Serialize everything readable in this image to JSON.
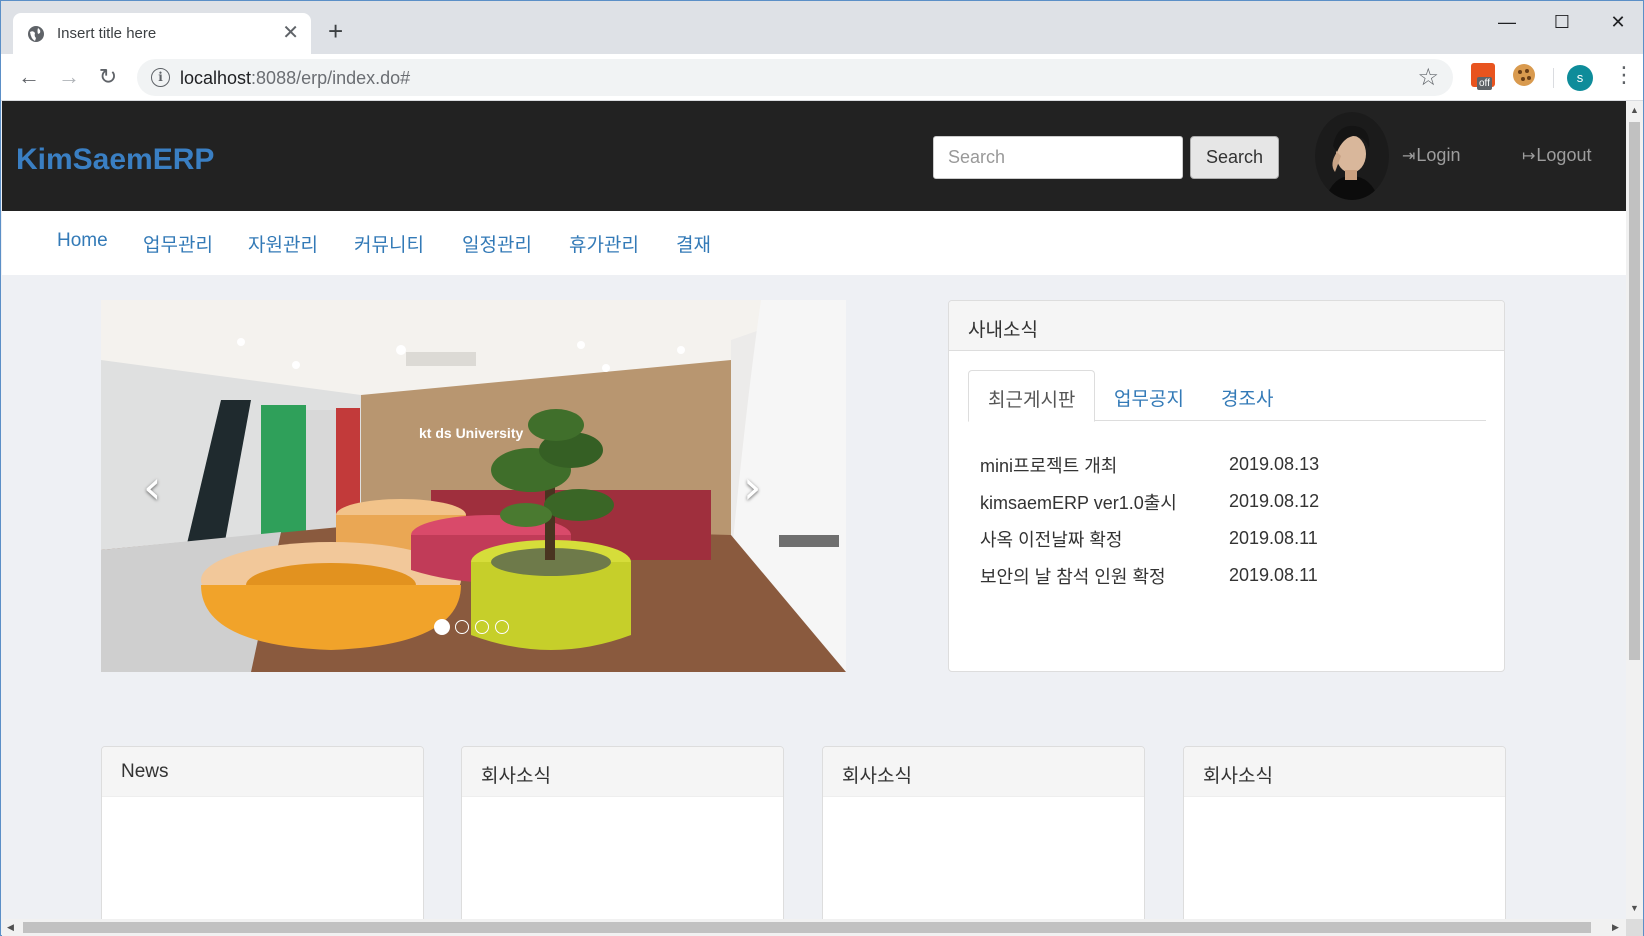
{
  "browser": {
    "tab_title": "Insert title here",
    "tab_close": "✕",
    "new_tab": "+",
    "url_host": "localhost",
    "url_path": ":8088/erp/index.do#",
    "window_controls": {
      "minimize": "—",
      "maximize": "☐",
      "close": "✕"
    },
    "profile_initial": "s",
    "extension_badge": "off",
    "icons": [
      "globe-icon",
      "back-arrow-icon",
      "forward-arrow-icon",
      "reload-icon",
      "info-icon",
      "star-icon",
      "menu-dots-icon"
    ]
  },
  "header": {
    "brand": "KimSaemERP",
    "search_placeholder": "Search",
    "search_button": "Search",
    "login_label": "Login",
    "logout_label": "Logout"
  },
  "menu": [
    "Home",
    "업무관리",
    "자원관리",
    "커뮤니티",
    "일정관리",
    "휴가관리",
    "결재"
  ],
  "carousel": {
    "prev": "‹",
    "next": "›",
    "slide_count": 4,
    "active_slide": 1,
    "sign_text": "kt ds  University"
  },
  "news_panel": {
    "title": "사내소식",
    "tabs": [
      "최근게시판",
      "업무공지",
      "경조사"
    ],
    "active_tab": 0,
    "rows": [
      {
        "title": "mini프로젝트 개최",
        "date": "2019.08.13"
      },
      {
        "title": "kimsaemERP ver1.0출시",
        "date": "2019.08.12"
      },
      {
        "title": "사옥 이전날짜 확정",
        "date": "2019.08.11"
      },
      {
        "title": "보안의 날 참석 인원 확정",
        "date": "2019.08.11"
      }
    ]
  },
  "bottom_panels": [
    "News",
    "회사소식",
    "회사소식",
    "회사소식"
  ],
  "colors": {
    "brand": "#3a7fc3",
    "navbar_bg": "#222222",
    "link": "#337ab7",
    "page_bg": "#eef0f4"
  }
}
